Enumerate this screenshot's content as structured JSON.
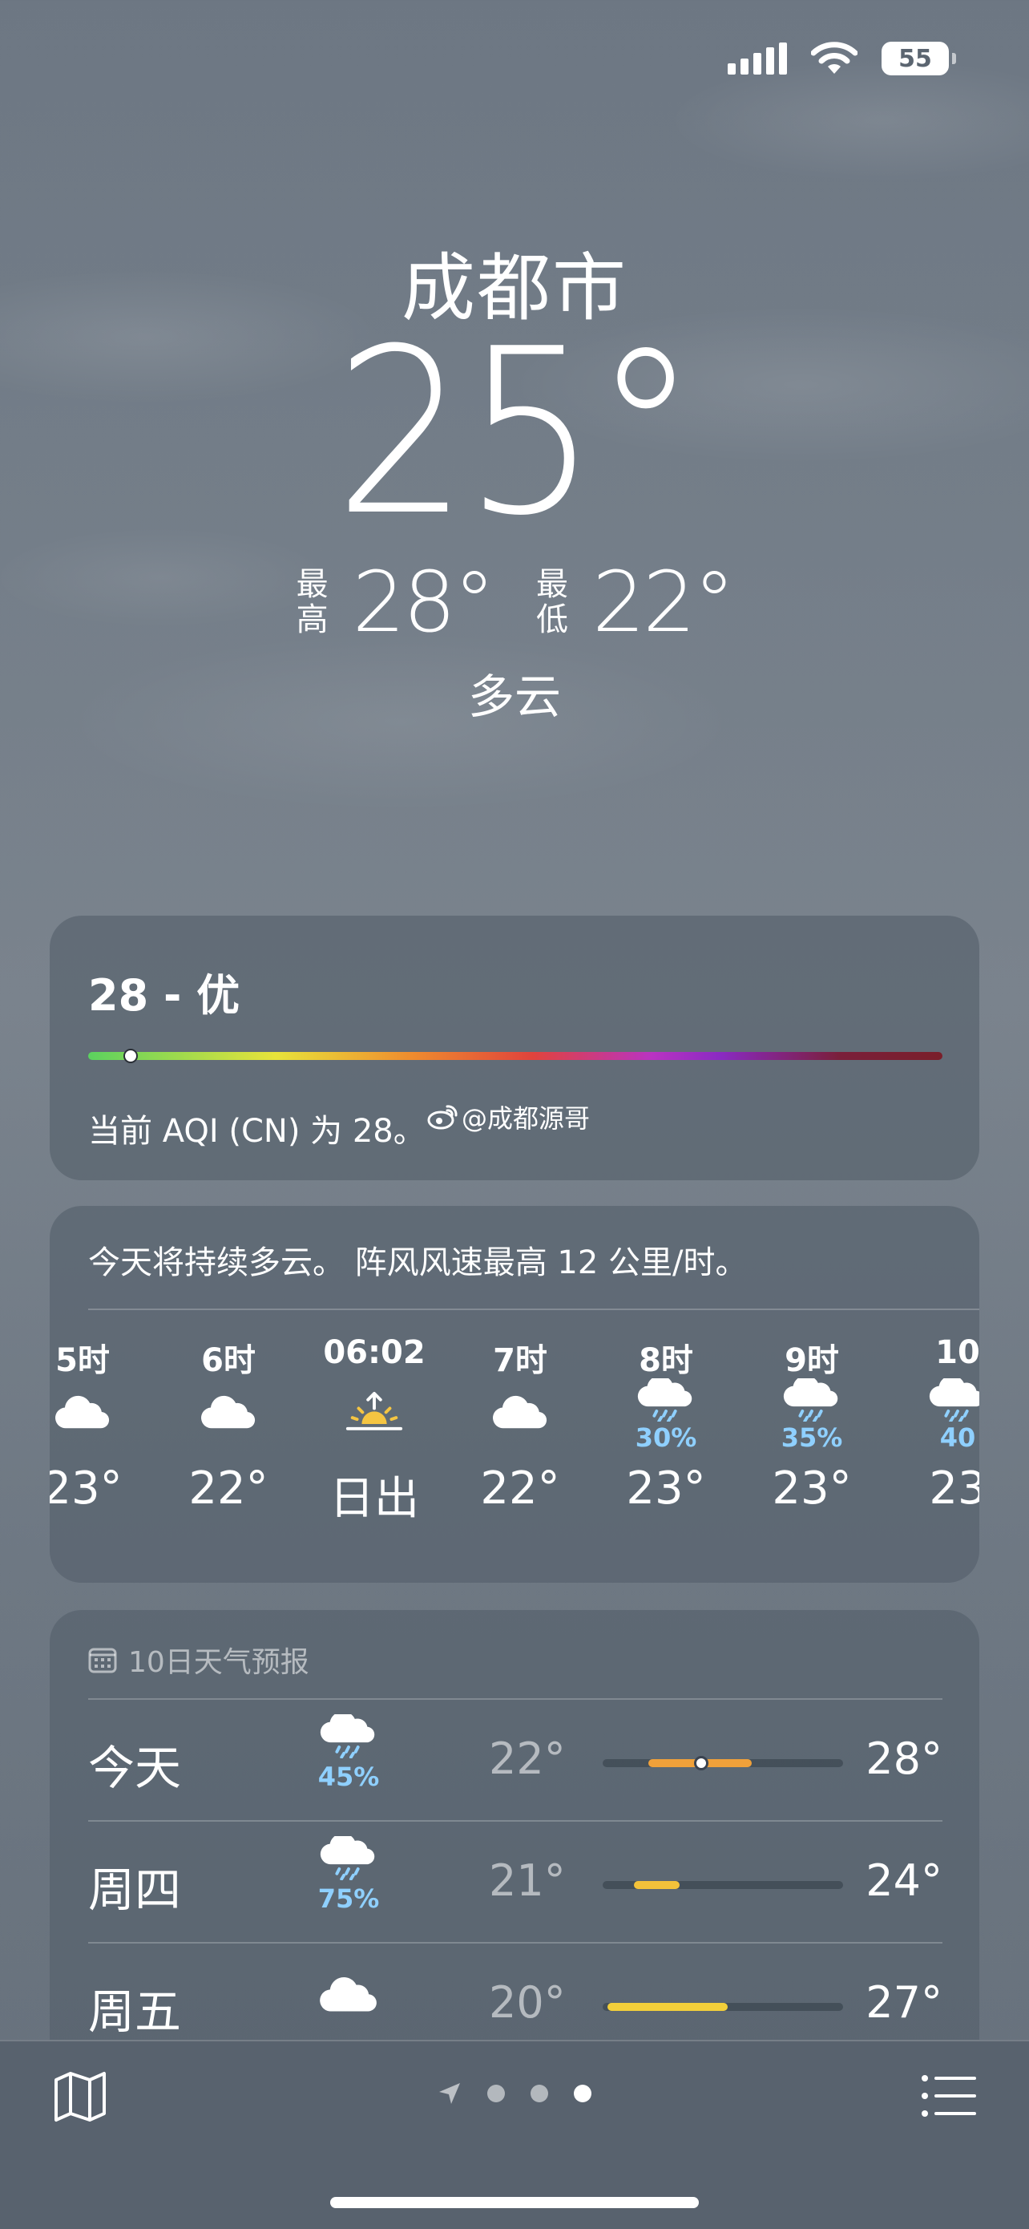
{
  "status_bar": {
    "battery": "55"
  },
  "location": {
    "city": "成都市",
    "temperature": "25°",
    "high_label": "最\n高",
    "high": "28°",
    "low_label": "最\n低",
    "low": "22°",
    "condition": "多云"
  },
  "aqi": {
    "value_label": "28 - 优",
    "level": 0.05,
    "description": "当前 AQI (CN) 为 28。",
    "watermark": "@成都源哥"
  },
  "hourly": {
    "summary": "今天将持续多云。 阵风风速最高 12 公里/时。",
    "items": [
      {
        "time": "5时",
        "icon": "cloud-icon",
        "precip": "",
        "value": "23°"
      },
      {
        "time": "6时",
        "icon": "cloud-icon",
        "precip": "",
        "value": "22°"
      },
      {
        "time": "06:02",
        "icon": "sunrise-icon",
        "precip": "",
        "value": "日出"
      },
      {
        "time": "7时",
        "icon": "cloud-icon",
        "precip": "",
        "value": "22°"
      },
      {
        "time": "8时",
        "icon": "cloud-rain-icon",
        "precip": "30%",
        "value": "23°"
      },
      {
        "time": "9时",
        "icon": "cloud-rain-icon",
        "precip": "35%",
        "value": "23°"
      },
      {
        "time": "10",
        "icon": "cloud-rain-icon",
        "precip": "40",
        "value": "23"
      }
    ]
  },
  "daily": {
    "header": "10日天气预报",
    "rows": [
      {
        "day": "今天",
        "icon": "cloud-rain-icon",
        "precip": "45%",
        "low": "22°",
        "high": "28°",
        "range_start": 0.19,
        "range_end": 0.62,
        "current": 0.41,
        "fill_color": "#f0a13a"
      },
      {
        "day": "周四",
        "icon": "cloud-rain-icon",
        "precip": "75%",
        "low": "21°",
        "high": "24°",
        "range_start": 0.13,
        "range_end": 0.32,
        "current": null,
        "fill_color": "#f3c23a"
      },
      {
        "day": "周五",
        "icon": "cloud-icon",
        "precip": "",
        "low": "20°",
        "high": "27°",
        "range_start": 0.02,
        "range_end": 0.52,
        "current": null,
        "fill_color": "#f3cf3a"
      }
    ]
  },
  "colors": {
    "precip": "#8fd0ff",
    "sun": "#f5c542"
  },
  "tabbar": {
    "pages": 3,
    "active_page": 3
  }
}
